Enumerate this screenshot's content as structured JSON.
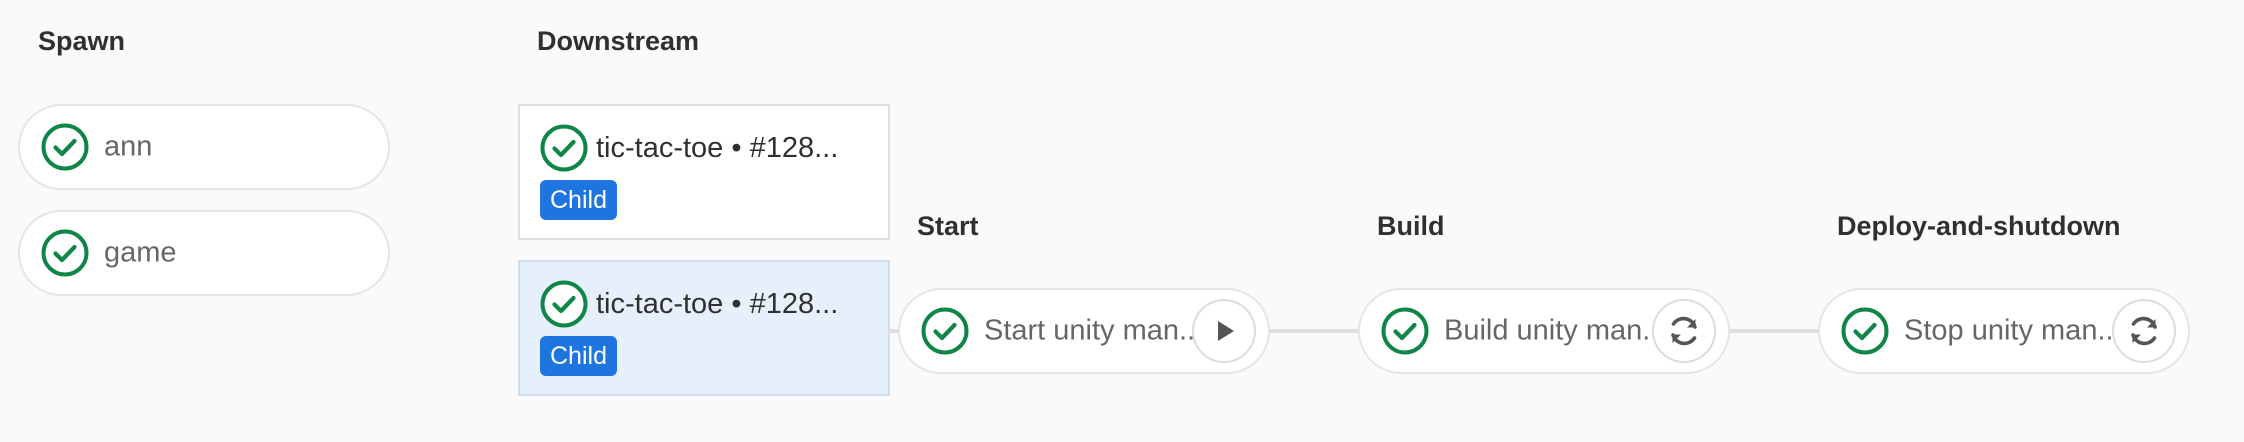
{
  "stages": {
    "spawn": "Spawn",
    "downstream": "Downstream",
    "start": "Start",
    "build": "Build",
    "deploy": "Deploy-and-shutdown"
  },
  "spawn_jobs": [
    {
      "label": "ann",
      "status": "success"
    },
    {
      "label": "game",
      "status": "success"
    }
  ],
  "downstream_pipelines": [
    {
      "title": "tic-tac-toe • #128...",
      "badge": "Child",
      "status": "success"
    },
    {
      "title": "tic-tac-toe • #128...",
      "badge": "Child",
      "status": "success"
    }
  ],
  "pipeline_jobs": {
    "start": {
      "label": "Start unity man...",
      "status": "success",
      "action": "play-icon"
    },
    "build": {
      "label": "Build unity man...",
      "status": "success",
      "action": "retry-icon"
    },
    "deploy": {
      "label": "Stop unity man...",
      "status": "success",
      "action": "retry-icon"
    }
  },
  "colors": {
    "success": "#108548",
    "badge": "#1f75e0",
    "active_card": "#e5f0fb"
  }
}
